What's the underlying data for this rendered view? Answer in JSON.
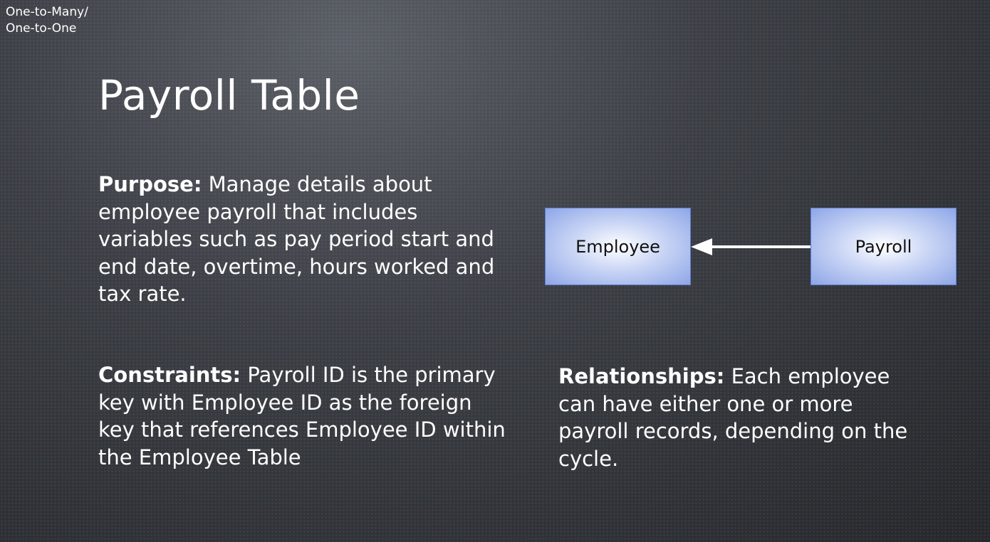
{
  "corner_note": {
    "line1": "One-to-Many/",
    "line2": "One-to-One"
  },
  "title": "Payroll Table",
  "purpose": {
    "label": "Purpose:",
    "text": " Manage details about employee payroll that includes variables such as pay period start and end date, overtime, hours worked and tax rate."
  },
  "constraints": {
    "label": "Constraints:",
    "text": " Payroll ID is the primary key with Employee ID  as the foreign key that references Employee ID within the Employee Table"
  },
  "relationships": {
    "label": "Relationships:",
    "text": " Each employee can have either one or more payroll records, depending on the cycle."
  },
  "diagram": {
    "source": "Employee",
    "target": "Payroll",
    "box_color": "#8ea6e8",
    "arrow_color": "#ffffff"
  }
}
